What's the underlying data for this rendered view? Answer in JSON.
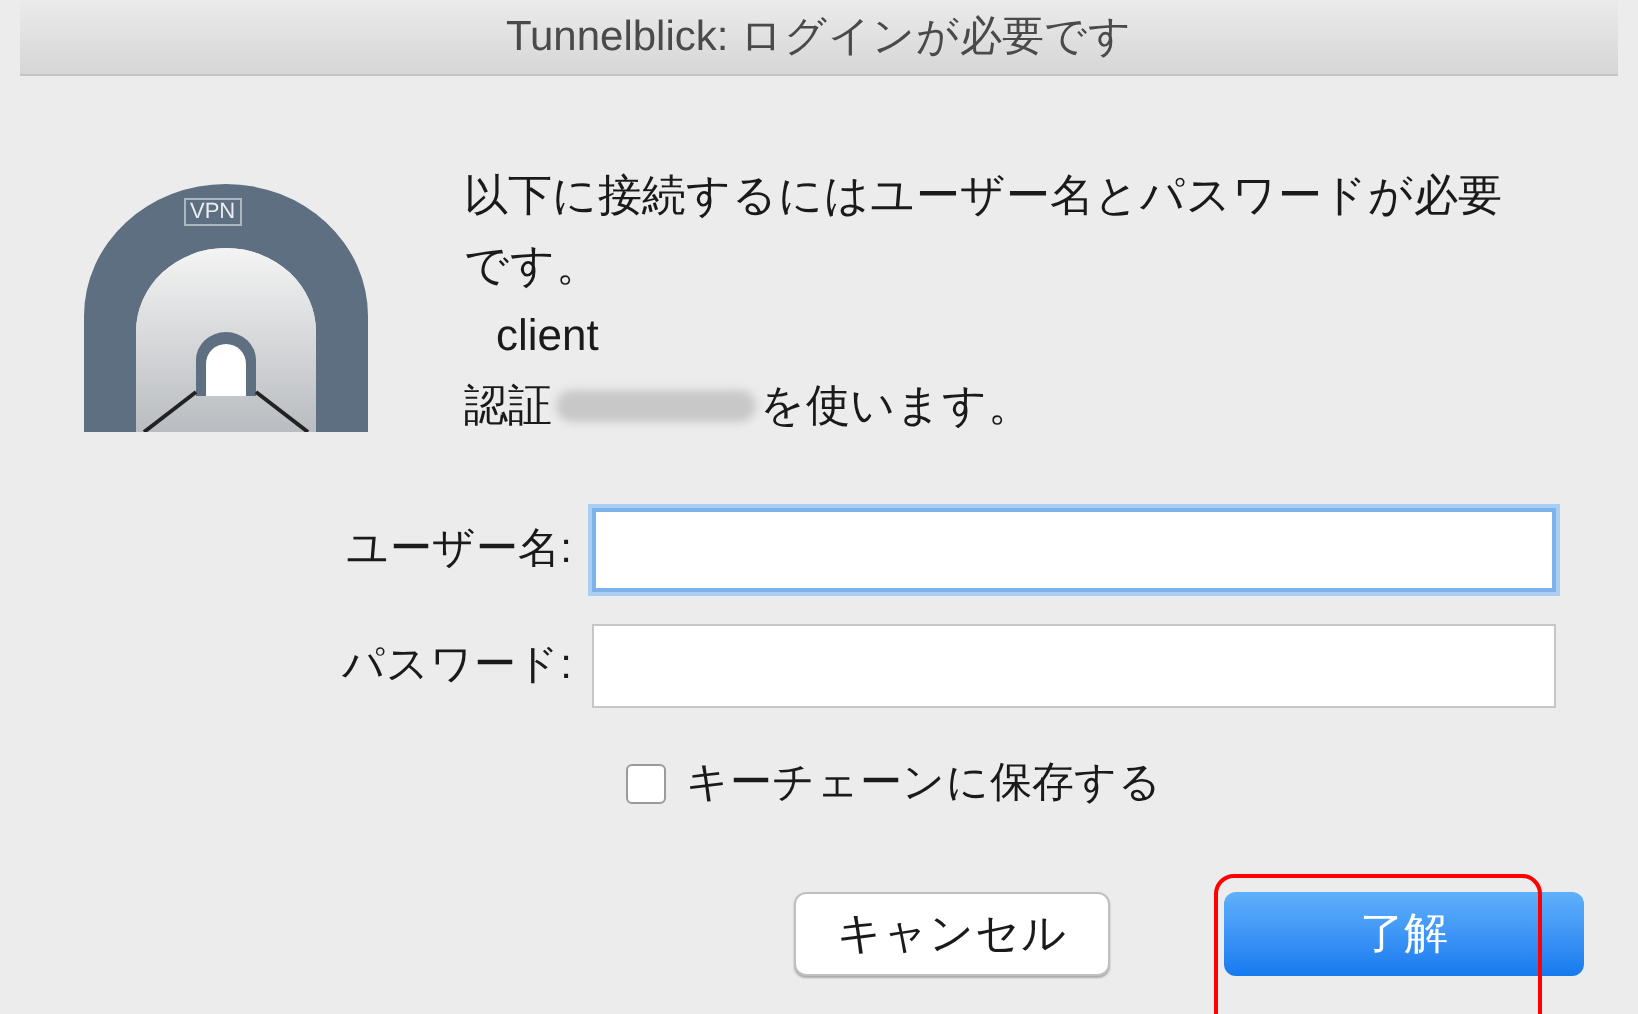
{
  "window": {
    "title": "Tunnelblick: ログインが必要です"
  },
  "app_icon": {
    "label": "VPN"
  },
  "message": {
    "line_1": "以下に接続するにはユーザー名とパスワードが必要です。",
    "connection": "client",
    "auth_prefix": "認証",
    "redacted": true,
    "auth_suffix": "を使います。"
  },
  "fields": [
    {
      "label": "ユーザー名:",
      "focused": true
    },
    {
      "label": "パスワード:",
      "focused": false
    }
  ],
  "keychain": {
    "label": "キーチェーンに保存する",
    "checked": false
  },
  "buttons": [
    {
      "label": "キャンセル",
      "default": false,
      "highlighted": false
    },
    {
      "label": "了解",
      "default": true,
      "highlighted": true
    }
  ]
}
